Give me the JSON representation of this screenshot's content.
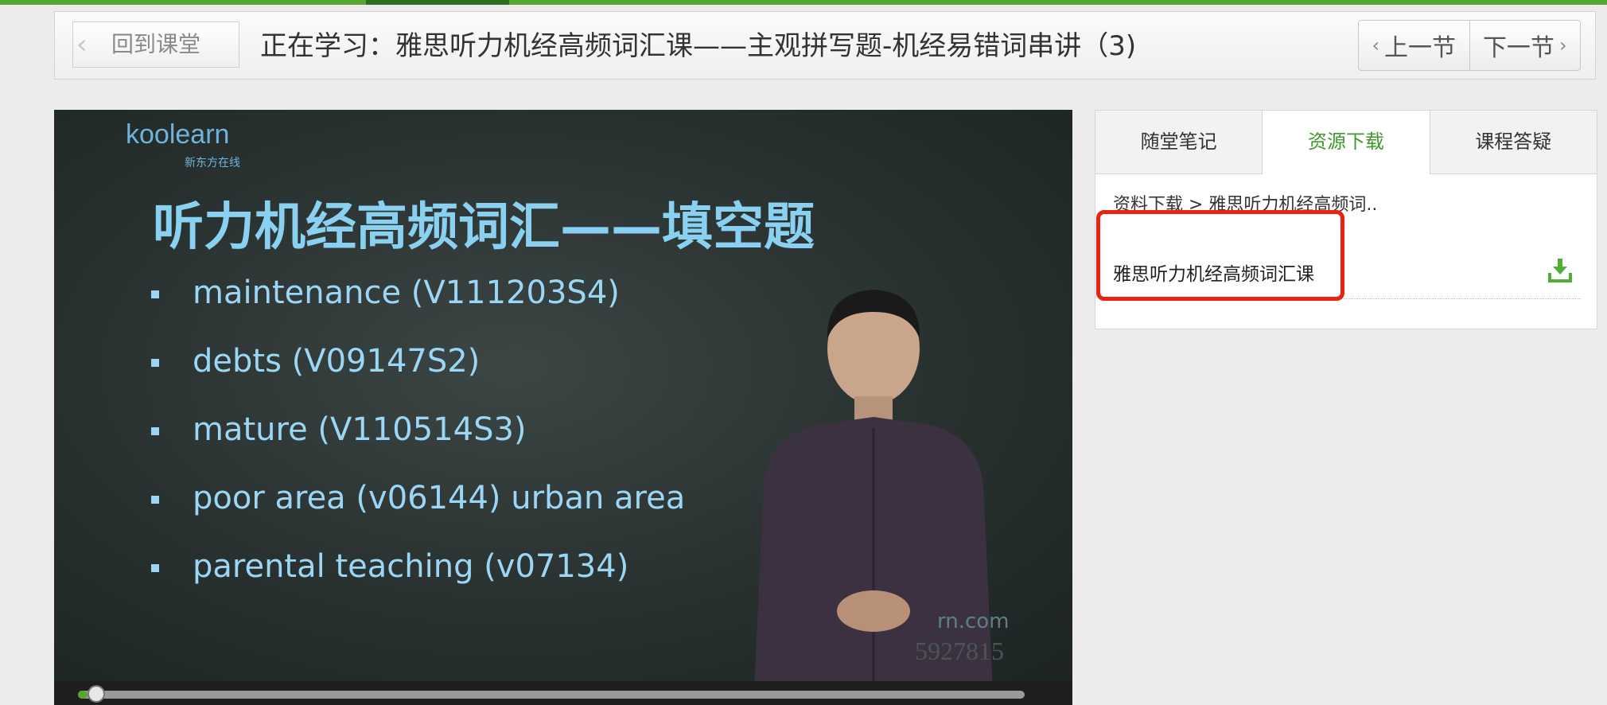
{
  "header": {
    "back_label": "回到课堂",
    "title": "正在学习：雅思听力机经高频词汇课——主观拼写题-机经易错词串讲（3)",
    "prev_label": "上一节",
    "next_label": "下一节"
  },
  "video": {
    "logo": "koolearn",
    "logo_sub": "新东方在线",
    "slide_title": "听力机经高频词汇——填空题",
    "bullets": [
      "maintenance (V111203S4)",
      "debts (V09147S2)",
      "mature (V110514S3)",
      "poor area  (v06144)  urban area",
      "parental teaching (v07134)"
    ],
    "watermark_url": "rn.com",
    "watermark_id": "5927815",
    "progress_fraction": 0.01
  },
  "sidebar": {
    "tabs": [
      {
        "label": "随堂笔记",
        "active": false
      },
      {
        "label": "资源下载",
        "active": true
      },
      {
        "label": "课程答疑",
        "active": false
      }
    ],
    "breadcrumb": "资料下载 > 雅思听力机经高频词..",
    "resources": [
      {
        "name": "雅思听力机经高频词汇课",
        "icon": "download-icon"
      }
    ]
  },
  "colors": {
    "accent": "#56a732",
    "active_tab": "#3f9a2e",
    "highlight": "#e8230f",
    "slide_text": "#9bd7f4"
  }
}
